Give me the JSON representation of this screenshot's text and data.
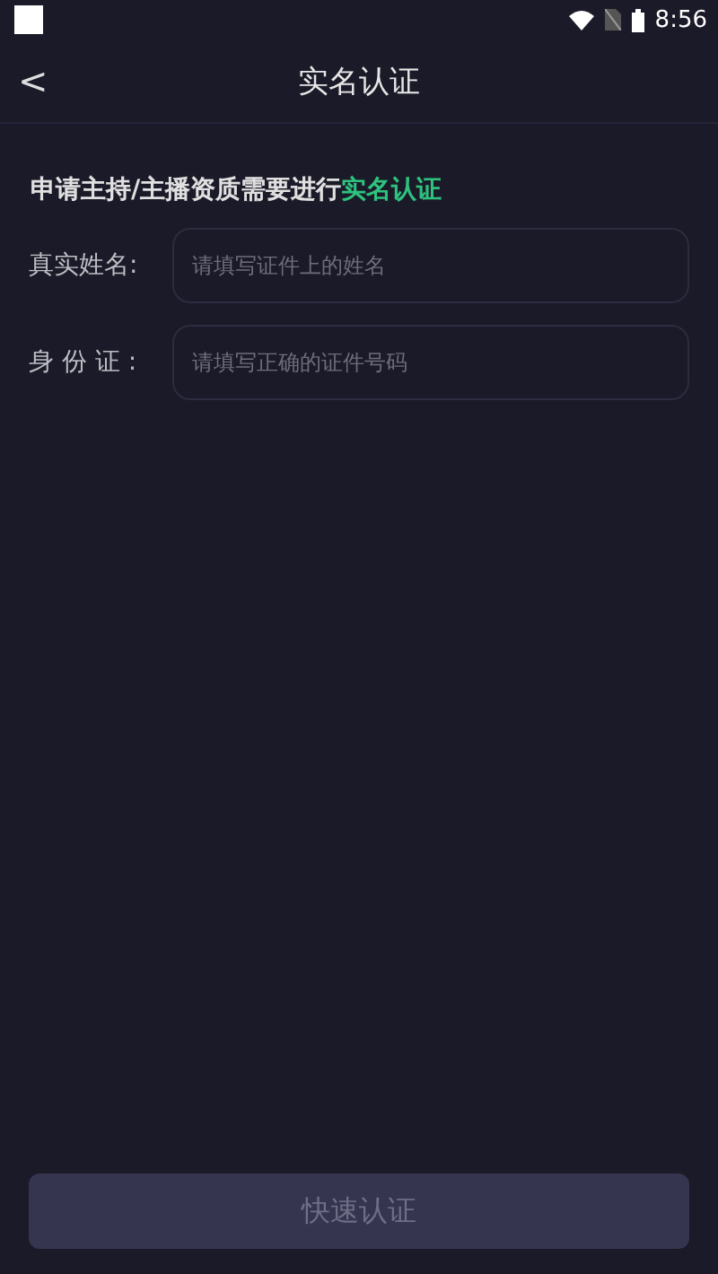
{
  "status_bar": {
    "time": "8:56"
  },
  "header": {
    "back": "<",
    "title": "实名认证"
  },
  "notice": {
    "text": "申请主持/主播资质需要进行",
    "highlight": "实名认证"
  },
  "fields": [
    {
      "label": "真实姓名:",
      "placeholder": "请填写证件上的姓名"
    },
    {
      "label": "身 份 证 :",
      "placeholder": "请填写正确的证件号码"
    }
  ],
  "submit": {
    "label": "快速认证",
    "disabled": true
  }
}
